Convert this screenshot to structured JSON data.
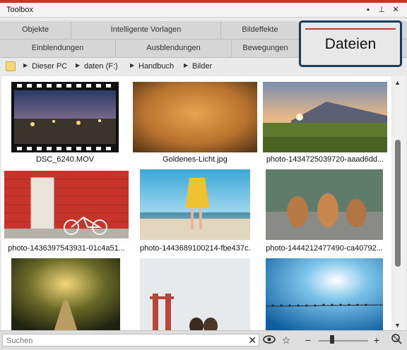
{
  "window": {
    "title": "Toolbox"
  },
  "tabs_row1": [
    "Objekte",
    "Intelligente Vorlagen",
    "Bildeffekte"
  ],
  "tabs_row2": [
    "Einblendungen",
    "Ausblendungen",
    "Bewegungen"
  ],
  "active_tab": "Dateien",
  "breadcrumb": [
    "Dieser PC",
    "daten (F:)",
    "Handbuch",
    "Bilder"
  ],
  "files": [
    {
      "name": "DSC_6240.MOV"
    },
    {
      "name": "Goldenes-Licht.jpg"
    },
    {
      "name": "photo-1434725039720-aaad6dd..."
    },
    {
      "name": "photo-1436397543931-01c4a51..."
    },
    {
      "name": "photo-1443689100214-fbe437c..."
    },
    {
      "name": "photo-1444212477490-ca40792..."
    },
    {
      "name": ""
    },
    {
      "name": ""
    },
    {
      "name": ""
    }
  ],
  "search": {
    "placeholder": "Suchen"
  },
  "icons": {
    "window_menu": "window-menu-icon",
    "pin": "pin-icon",
    "close": "close-icon",
    "eye": "eye-icon",
    "star": "star-icon",
    "zoom_out": "minus-icon",
    "zoom_in": "plus-icon",
    "reset_zoom": "zoom-reset-icon"
  },
  "colors": {
    "accent_red": "#c0392b",
    "callout_border": "#173a5f"
  }
}
